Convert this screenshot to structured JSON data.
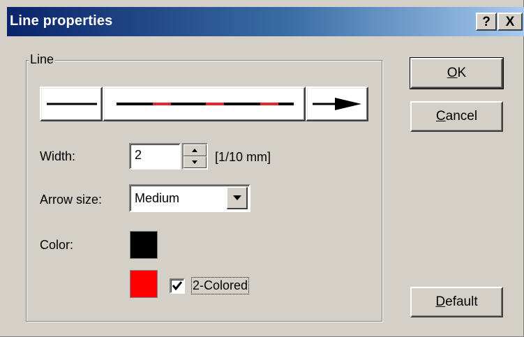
{
  "window": {
    "title": "Line properties",
    "help_label": "?",
    "close_label": "X"
  },
  "group": {
    "label": "Line"
  },
  "line_style": {
    "start_icon": "plain-line-end-icon",
    "middle_icon": "two-colored-line-icon",
    "end_icon": "arrow-line-end-icon",
    "primary_color": "#000000",
    "secondary_color": "#e8252a"
  },
  "width": {
    "label": "Width:",
    "value": "2",
    "unit": "[1/10 mm]"
  },
  "arrow_size": {
    "label": "Arrow size:",
    "value": "Medium"
  },
  "color": {
    "label": "Color:",
    "primary": "#000000",
    "secondary": "#ff0000"
  },
  "two_colored": {
    "label": "2-Colored",
    "checked": true
  },
  "buttons": {
    "ok": {
      "accel": "O",
      "rest": "K"
    },
    "cancel": {
      "accel": "C",
      "rest": "ancel"
    },
    "default": {
      "accel": "D",
      "rest": "efault"
    }
  }
}
